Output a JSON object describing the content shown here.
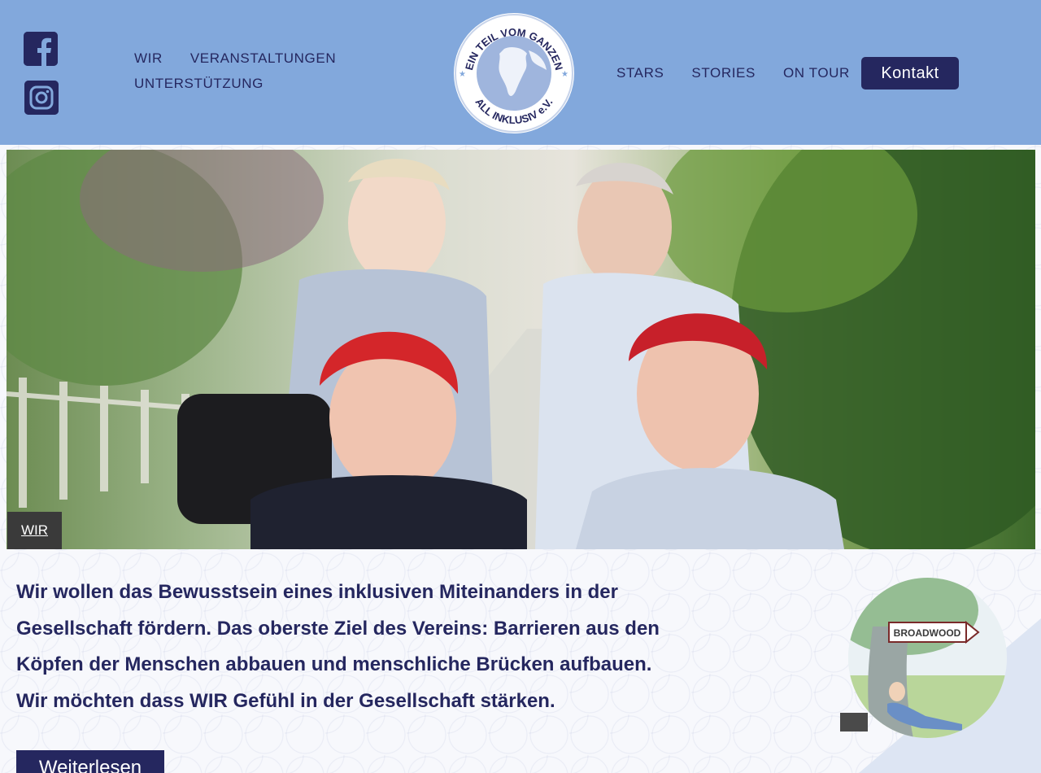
{
  "header": {
    "nav_left": [
      "WIR",
      "VERANSTALTUNGEN",
      "UNTERSTÜTZUNG"
    ],
    "nav_right": [
      "STARS",
      "STORIES",
      "ON TOUR"
    ],
    "kontakt_label": "Kontakt",
    "logo_text_top": "EIN TEIL VOM GANZEN",
    "logo_text_bottom": "ALL INKLUSIV e.V.",
    "social": [
      "facebook-icon",
      "instagram-icon"
    ]
  },
  "hero": {
    "label": "WIR"
  },
  "intro": {
    "text": "Wir wollen das Bewusstsein eines inklusiven Miteinanders in der Gesellschaft fördern. Das oberste Ziel des Vereins: Barrieren aus den Köpfen der Menschen abbauen und menschliche Brücken aufbauen. Wir möchten dass WIR Gefühl in der Gesellschaft stärken.",
    "button_label": "Weiterlesen"
  },
  "illustration": {
    "sign_text": "BROADWOOD"
  },
  "colors": {
    "header_bg": "#82a8dc",
    "primary": "#25275f",
    "white": "#ffffff"
  }
}
